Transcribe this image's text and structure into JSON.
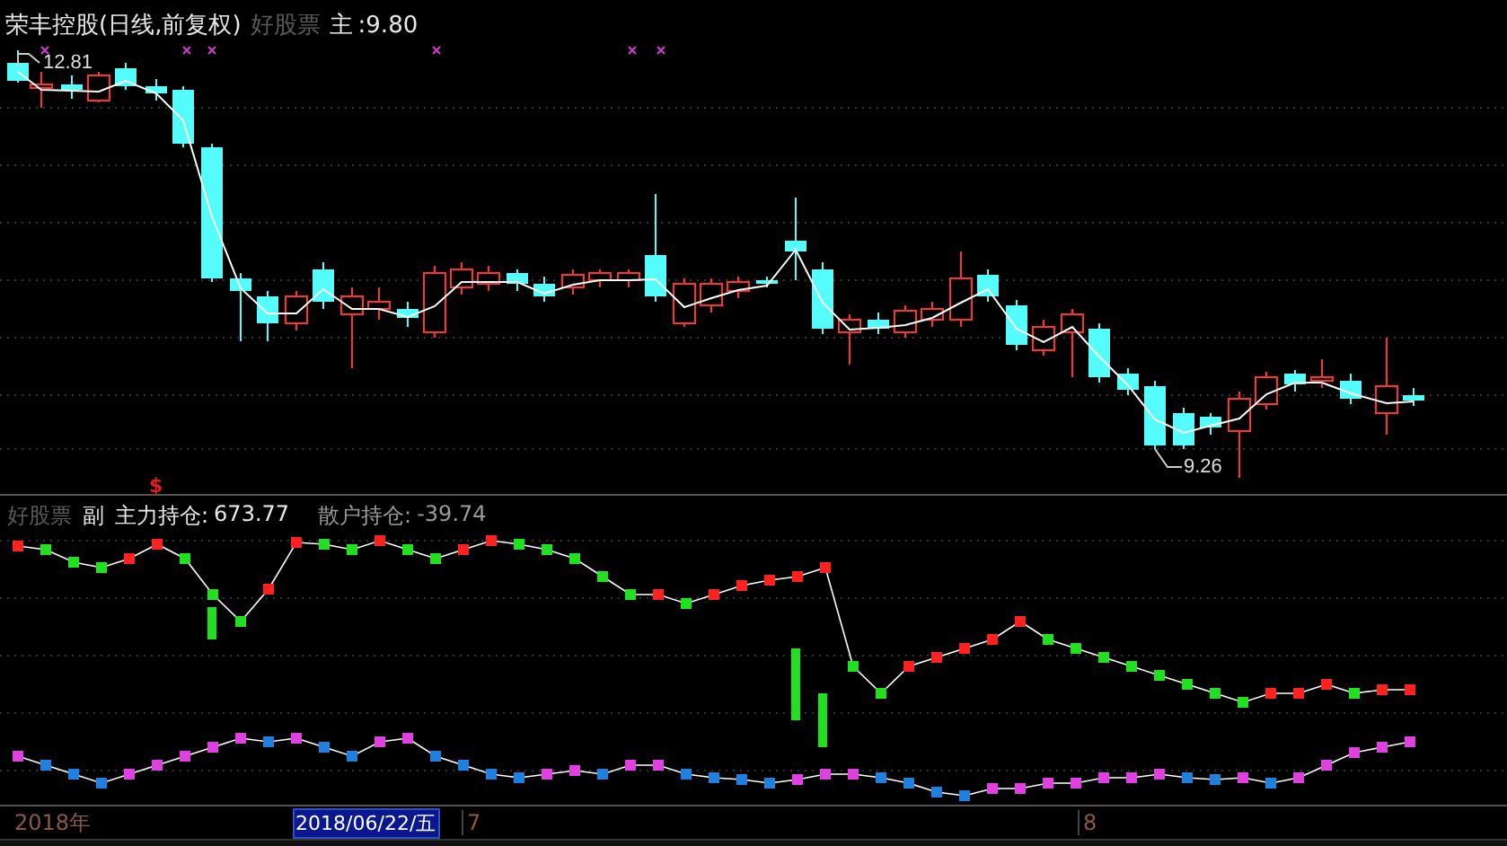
{
  "main_panel": {
    "title": "荣丰控股(日线,前复权)",
    "formula_name": "好股票",
    "line_label": "主",
    "line_value": ":9.80",
    "high_label": "12.81",
    "low_label": "9.26"
  },
  "sub_panel": {
    "formula_name": "好股票",
    "panel_label": "副",
    "marker": "$",
    "readings": [
      {
        "label": "主力持仓:",
        "value": "673.77",
        "kind": "main"
      },
      {
        "label": "散户持仓:",
        "value": "-39.74",
        "kind": "retail"
      }
    ]
  },
  "time_axis": {
    "year": "2018年",
    "cursor_date": "2018/06/22/五",
    "month_ticks": [
      "7",
      "8"
    ]
  }
}
